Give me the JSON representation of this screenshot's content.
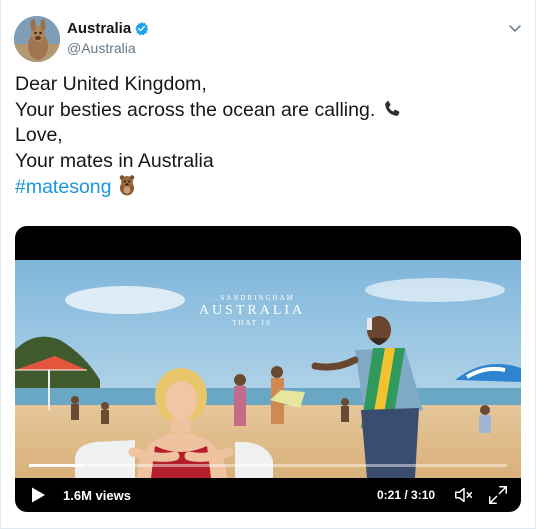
{
  "tweet": {
    "display_name": "Australia",
    "handle": "@Australia",
    "verified": true,
    "lines": [
      "Dear United Kingdom,",
      "Your besties across the ocean are calling.",
      "Love,",
      "Your mates in Australia"
    ],
    "hashtag": "#matesong",
    "emojis": [
      "telephone-emoji",
      "quokka-emoji"
    ]
  },
  "video": {
    "overlay_small_top": "...SANDRINGHAM",
    "overlay_title": "AUSTRALIA",
    "overlay_small_bottom": "THAT IS",
    "views": "1.6M views",
    "time": "0:21 / 3:10",
    "progress_fraction": 0.11
  },
  "colors": {
    "link": "#1b95e0",
    "verified": "#1da1f2",
    "secondary_text": "#657786"
  }
}
